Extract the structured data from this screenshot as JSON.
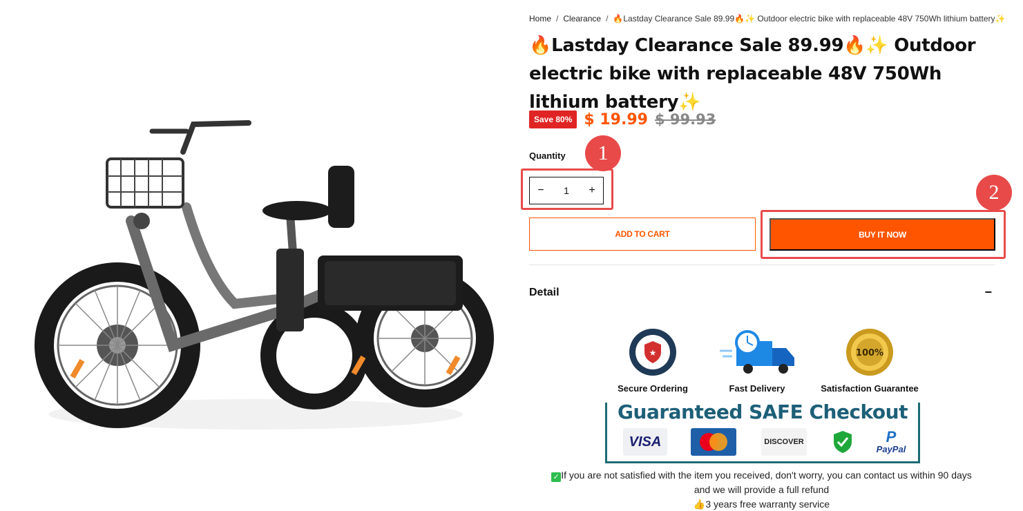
{
  "breadcrumb": {
    "home": "Home",
    "sep1": "/",
    "clearance": "Clearance",
    "sep2": "/",
    "current": "🔥Lastday Clearance Sale 89.99🔥✨ Outdoor electric bike with replaceable 48V 750Wh lithium battery✨"
  },
  "product": {
    "title": "🔥Lastday Clearance Sale 89.99🔥✨ Outdoor electric bike with replaceable 48V 750Wh lithium battery✨",
    "save_badge": "Save 80%",
    "price": "$ 19.99",
    "compare_price": "$ 99.93",
    "image_icon": "electric-tricycle-image"
  },
  "quantity": {
    "label": "Quantity",
    "minus": "−",
    "plus": "+",
    "value": "1"
  },
  "actions": {
    "add_to_cart": "ADD TO CART",
    "buy_now": "BUY IT NOW"
  },
  "markers": {
    "one": "1",
    "two": "2"
  },
  "detail": {
    "heading": "Detail",
    "toggle": "−"
  },
  "badges": {
    "secure_ordering": "Secure Ordering",
    "fast_delivery": "Fast Delivery",
    "satisfaction": "Satisfaction Guarantee",
    "secure_seal_text": "SECURE ORDERING",
    "money_back_text": "100%"
  },
  "checkout": {
    "title": "Guaranteed SAFE Checkout",
    "visa": "VISA",
    "mastercard": "MasterCard",
    "discover": "DISCOVER",
    "paypal": "PayPal"
  },
  "notes": {
    "line1": "If you are not satisfied with the item you received, don't worry, you can contact us within 90 days",
    "line2": "and we will provide a full refund",
    "line3": "3 years free warranty service"
  },
  "colors": {
    "accent": "#ff5500",
    "badge_red": "#e02424",
    "marker_red": "#e84a4a",
    "checkout_teal": "#1d5f78"
  }
}
